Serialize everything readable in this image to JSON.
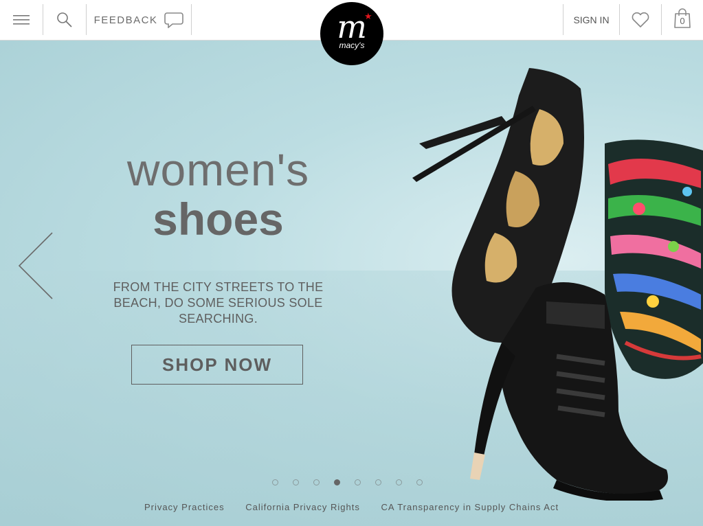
{
  "header": {
    "feedback_label": "FEEDBACK",
    "signin_label": "SIGN IN",
    "bag_count": "0",
    "logo_text": "macy's",
    "icons": {
      "menu": "hamburger-icon",
      "search": "search-icon",
      "feedback": "speech-bubble-icon",
      "wishlist": "heart-icon",
      "bag": "shopping-bag-icon"
    }
  },
  "hero": {
    "title_line1": "women's",
    "title_line2": "shoes",
    "subtitle": "FROM THE CITY STREETS TO THE BEACH, DO SOME SERIOUS SOLE SEARCHING.",
    "cta_label": "SHOP NOW",
    "prev_icon": "chevron-left-icon"
  },
  "carousel": {
    "dot_count": 8,
    "active_index": 3
  },
  "footer": {
    "links": [
      "Privacy Practices",
      "California Privacy Rights",
      "CA Transparency in Supply Chains Act"
    ]
  },
  "colors": {
    "logo_bg": "#000000",
    "logo_star": "#e2161d",
    "hero_bg": "#bcdde2",
    "text_gray": "#666666"
  }
}
